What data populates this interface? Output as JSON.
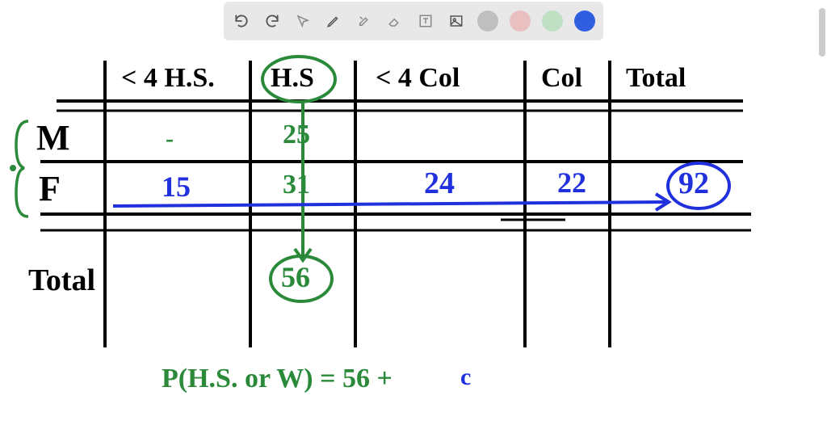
{
  "toolbar": {
    "colors": {
      "gray": "#bfbfbf",
      "pink": "#e9bfbf",
      "green": "#bfe0c3",
      "blue": "#2f5fe0"
    }
  },
  "table": {
    "headers": {
      "col1": "< 4 H.S.",
      "col2": "H.S",
      "col3": "< 4 Col",
      "col4": "Col",
      "col5": "Total"
    },
    "rows": {
      "m": {
        "label": "M",
        "col1": "-",
        "col2": "25"
      },
      "f": {
        "label": "F",
        "col1": "15",
        "col2": "31",
        "col3": "24",
        "col4": "22",
        "col5": "92"
      },
      "total": {
        "label": "Total",
        "col2": "56"
      }
    }
  },
  "equation": {
    "text": "P(H.S. or W) = 56 + "
  }
}
